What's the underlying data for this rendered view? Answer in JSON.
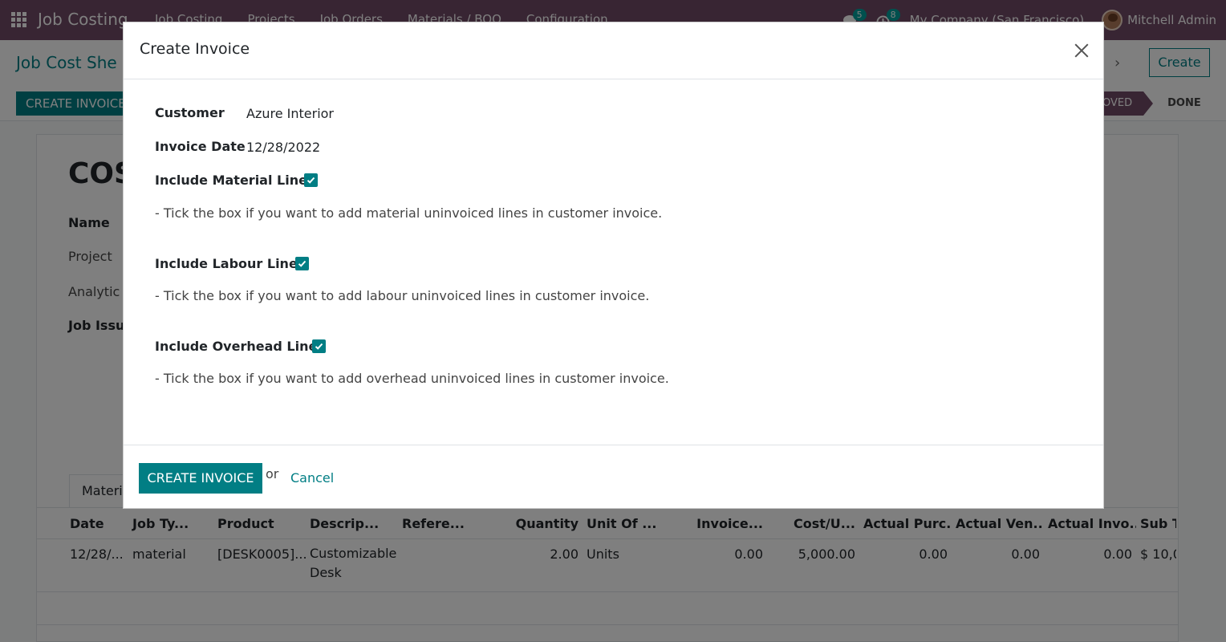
{
  "navbar": {
    "brand": "Job Costing",
    "menu": [
      "Job Costing",
      "Projects",
      "Job Orders",
      "Materials / BOQ",
      "Configuration"
    ],
    "messages_count": "5",
    "activities_count": "8",
    "company": "My Company (San Francisco)",
    "user": "Mitchell Admin"
  },
  "control": {
    "breadcrumb": "Job Cost She",
    "create_label": "Create",
    "action_button": "CREATE INVOICE",
    "status_approved": "OVED",
    "status_done": "DONE"
  },
  "sheet": {
    "title": "COS",
    "labels": {
      "name": "Name",
      "project": "Project",
      "analytic": "Analytic A",
      "job_issue": "Job Issue"
    },
    "tab": "Materia"
  },
  "table": {
    "headers": [
      "Date",
      "Job Ty...",
      "Product",
      "Descrip...",
      "Refere...",
      "Quantity",
      "Unit Of ...",
      "Invoice...",
      "Cost/U...",
      "Actual Purc...",
      "Actual Ven...",
      "Actual Invo...",
      "Sub To"
    ],
    "rows": [
      {
        "date": "12/28/...",
        "job_type": "material",
        "product": "[DESK0005]...",
        "description": "Customizable Desk",
        "reference": "",
        "quantity": "2.00",
        "uom": "Units",
        "invoiced": "0.00",
        "cost_unit": "5,000.00",
        "actual_purchase": "0.00",
        "actual_vendor": "0.00",
        "actual_invoice": "0.00",
        "subtotal": "$ 10,0"
      }
    ]
  },
  "modal": {
    "title": "Create Invoice",
    "customer_label": "Customer",
    "customer_value": "Azure Interior",
    "invoice_date_label": "Invoice Date",
    "invoice_date_value": "12/28/2022",
    "material_label": "Include Material Lines",
    "material_checked": true,
    "material_help": "- Tick the box if you want to add material uninvoiced lines in customer invoice.",
    "labour_label": "Include Labour Lines",
    "labour_checked": true,
    "labour_help": "- Tick the box if you want to add labour uninvoiced lines in customer invoice.",
    "overhead_label": "Include Overhead Lines",
    "overhead_checked": true,
    "overhead_help": "- Tick the box if you want to add overhead uninvoiced lines in customer invoice.",
    "create_button": "CREATE INVOICE",
    "or_text": "or",
    "cancel_label": "Cancel"
  },
  "colors": {
    "navbar": "#714b67",
    "primary": "#017e84",
    "backdrop": "rgba(0,0,0,0.5)"
  }
}
